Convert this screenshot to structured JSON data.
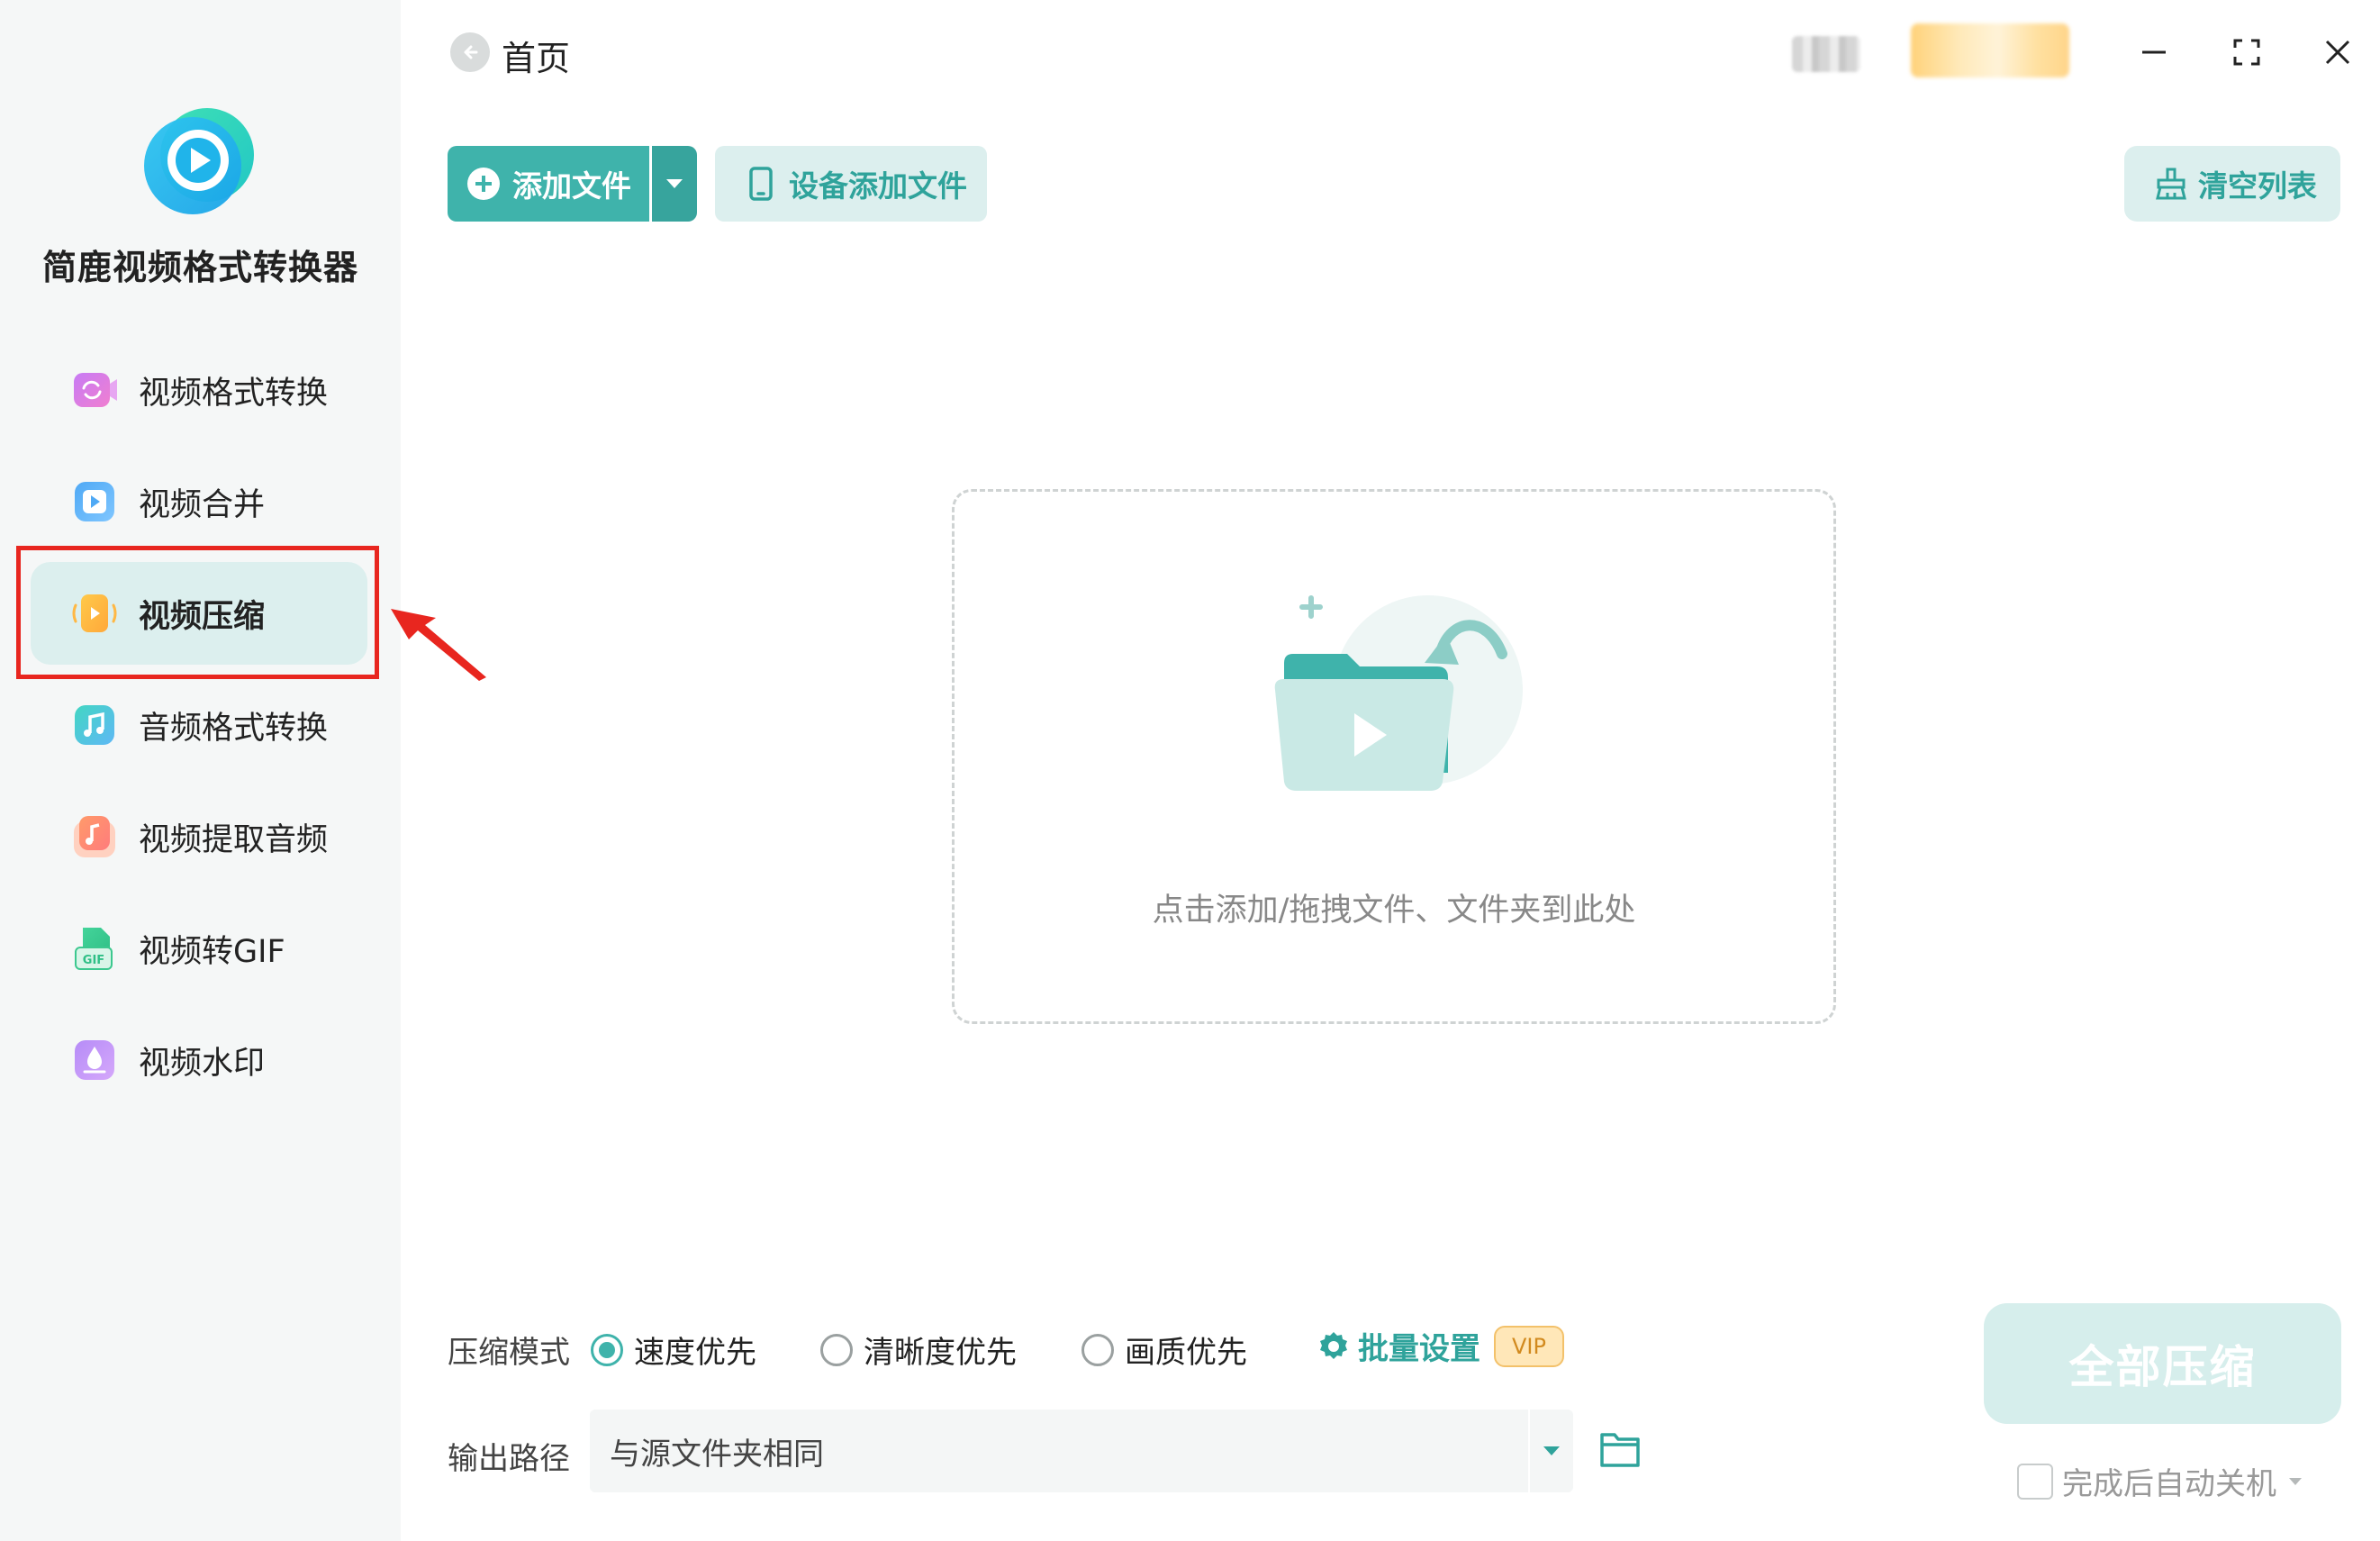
{
  "app": {
    "title": "简鹿视频格式转换器",
    "colors": {
      "accent": "#3fb3ab",
      "accent_light": "#dcefee",
      "highlight_red": "#e8261f"
    }
  },
  "sidebar": {
    "items": [
      {
        "label": "视频格式转换",
        "icon": "video-convert-icon",
        "active": false
      },
      {
        "label": "视频合并",
        "icon": "video-merge-icon",
        "active": false
      },
      {
        "label": "视频压缩",
        "icon": "video-compress-icon",
        "active": true
      },
      {
        "label": "音频格式转换",
        "icon": "audio-convert-icon",
        "active": false
      },
      {
        "label": "视频提取音频",
        "icon": "extract-audio-icon",
        "active": false
      },
      {
        "label": "视频转GIF",
        "icon": "video-to-gif-icon",
        "active": false
      },
      {
        "label": "视频水印",
        "icon": "video-watermark-icon",
        "active": false
      }
    ]
  },
  "header": {
    "back_label": "首页"
  },
  "toolbar": {
    "add_file": "添加文件",
    "device_add": "设备添加文件",
    "clear_list": "清空列表"
  },
  "dropzone": {
    "hint": "点击添加/拖拽文件、文件夹到此处"
  },
  "settings": {
    "mode_label": "压缩模式",
    "modes": [
      {
        "label": "速度优先",
        "checked": true
      },
      {
        "label": "清晰度优先",
        "checked": false
      },
      {
        "label": "画质优先",
        "checked": false
      }
    ],
    "batch_label": "批量设置",
    "vip_label": "VIP",
    "output_label": "输出路径",
    "output_value": "与源文件夹相同"
  },
  "actions": {
    "compress_all": "全部压缩",
    "shutdown_after": "完成后自动关机"
  }
}
